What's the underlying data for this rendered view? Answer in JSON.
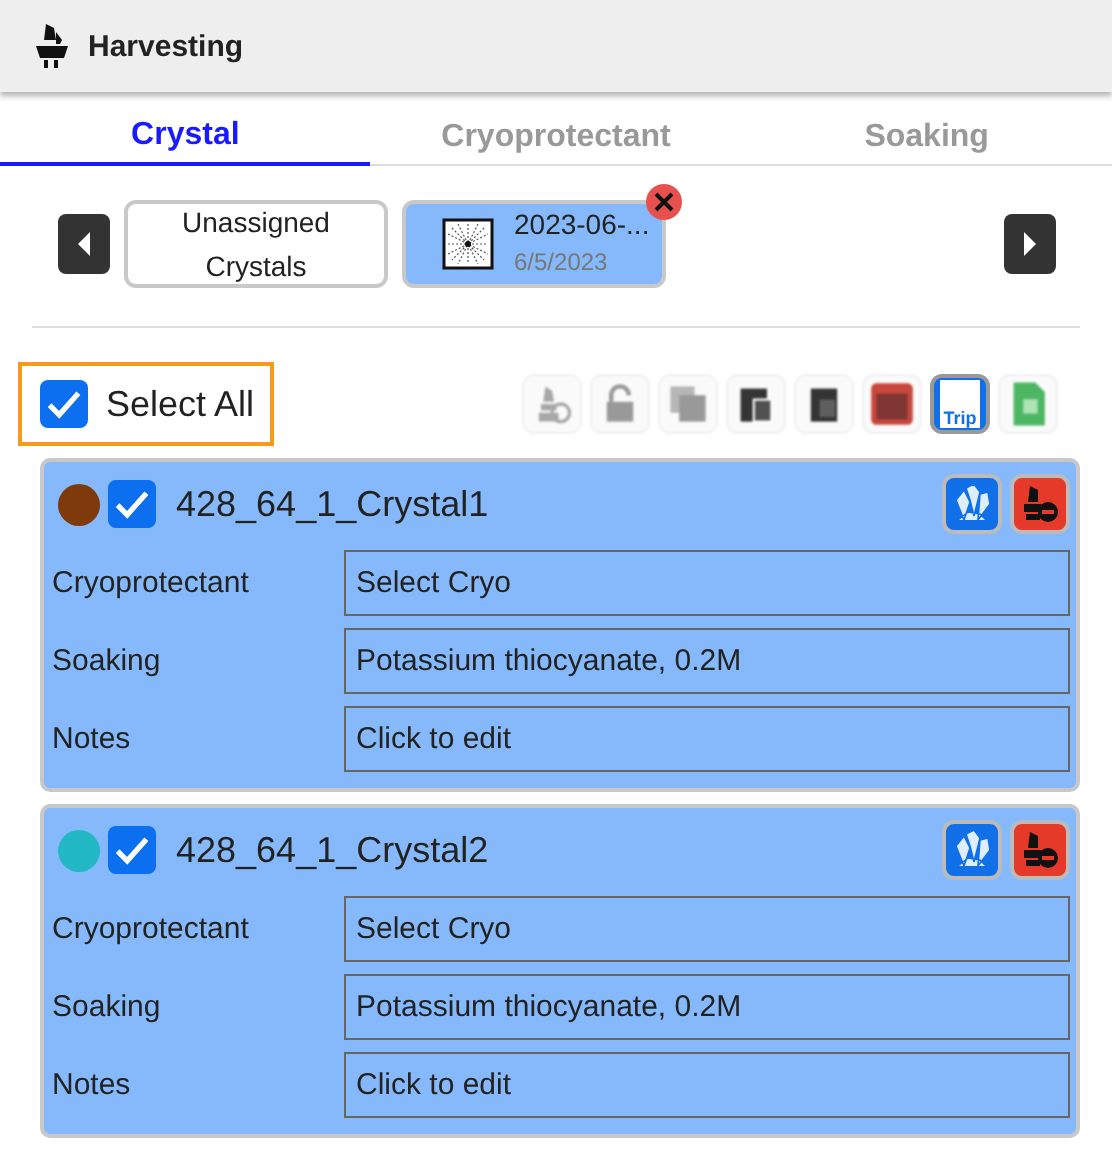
{
  "header": {
    "title": "Harvesting"
  },
  "tabs": [
    {
      "label": "Crystal",
      "selected": true,
      "disabled": false
    },
    {
      "label": "Cryoprotectant",
      "selected": false,
      "disabled": true
    },
    {
      "label": "Soaking",
      "selected": false,
      "disabled": true
    }
  ],
  "carousel": {
    "items": [
      {
        "kind": "text",
        "label": "Unassigned Crystals",
        "selected": false
      },
      {
        "kind": "plate",
        "label": "2023-06-...",
        "date": "6/5/2023",
        "selected": true,
        "removable": true
      }
    ]
  },
  "select_all": {
    "label": "Select All",
    "checked": true
  },
  "toolbar": [
    {
      "kind": "harvest",
      "disabled": true
    },
    {
      "kind": "lock",
      "disabled": true
    },
    {
      "kind": "copy",
      "disabled": true
    },
    {
      "kind": "paste",
      "disabled": true
    },
    {
      "kind": "clipboard",
      "disabled": true
    },
    {
      "kind": "delete",
      "disabled": true
    },
    {
      "kind": "trip",
      "label": "Trip",
      "disabled": false
    },
    {
      "kind": "sheet",
      "disabled": true
    }
  ],
  "crystals": [
    {
      "name": "428_64_1_Crystal1",
      "color": "#7f3a0b",
      "checked": true,
      "fields": [
        {
          "label": "Cryoprotectant",
          "value": "Select Cryo"
        },
        {
          "label": "Soaking",
          "value": "Potassium thiocyanate, 0.2M"
        },
        {
          "label": "Notes",
          "value": "Click to edit"
        }
      ]
    },
    {
      "name": "428_64_1_Crystal2",
      "color": "#22b8c4",
      "checked": true,
      "fields": [
        {
          "label": "Cryoprotectant",
          "value": "Select Cryo"
        },
        {
          "label": "Soaking",
          "value": "Potassium thiocyanate, 0.2M"
        },
        {
          "label": "Notes",
          "value": "Click to edit"
        }
      ]
    }
  ]
}
